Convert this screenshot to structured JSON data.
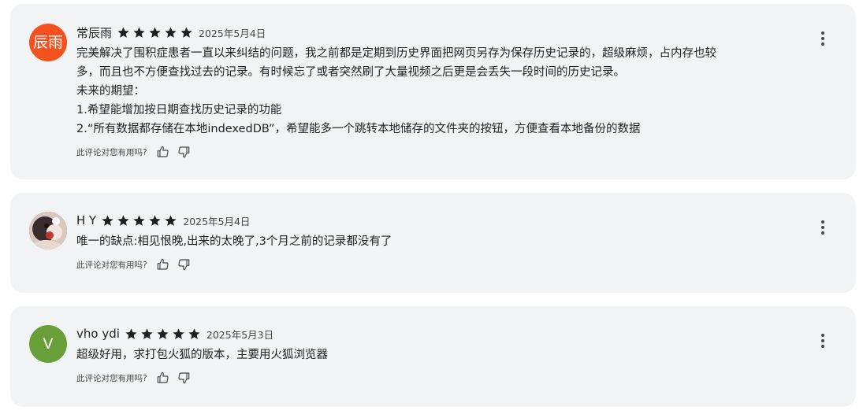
{
  "helpful_prompt": "此评论对您有用吗?",
  "colors": {
    "card_bg": "#f1f3f4",
    "star": "#1f1f1f",
    "avatar_orange": "#f4511e",
    "avatar_green": "#689f38"
  },
  "reviews": [
    {
      "name": "常辰雨",
      "avatar_text": "辰雨",
      "rating": 5,
      "date": "2025年5月4日",
      "lines": [
        "完美解决了围积症患者一直以来纠结的问题，我之前都是定期到历史界面把网页另存为保存历史记录的，超级麻烦，占内存也较",
        "多，而且也不方便查找过去的记录。有时候忘了或者突然刷了大量视频之后更是会丢失一段时间的历史记录。",
        "未来的期望：",
        "1.希望能增加按日期查找历史记录的功能",
        "2.“所有数据都存储在本地indexedDB”，希望能多一个跳转本地储存的文件夹的按钮，方便查看本地备份的数据"
      ]
    },
    {
      "name": "H Y",
      "avatar_text": "",
      "rating": 5,
      "date": "2025年5月4日",
      "lines": [
        "唯一的缺点:相见恨晚,出来的太晚了,3个月之前的记录都没有了"
      ]
    },
    {
      "name": "vho ydi",
      "avatar_text": "V",
      "rating": 5,
      "date": "2025年5月3日",
      "lines": [
        "超级好用，求打包火狐的版本，主要用火狐浏览器"
      ]
    }
  ]
}
